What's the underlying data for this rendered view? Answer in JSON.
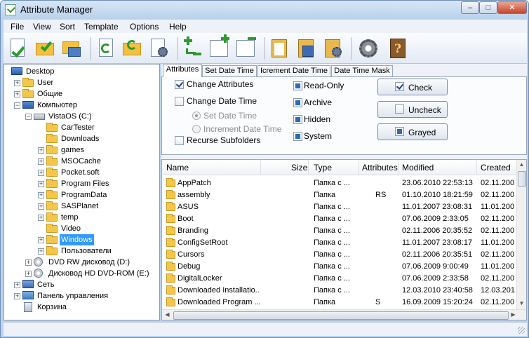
{
  "window": {
    "title": "Attribute Manager",
    "controls": {
      "minimize": "–",
      "maximize": "□",
      "close": "✕"
    }
  },
  "menu": [
    "File",
    "View",
    "Sort",
    "Template",
    "Options",
    "Help"
  ],
  "toolbar": [
    {
      "icon": "document-check-icon"
    },
    {
      "icon": "folder-check-icon"
    },
    {
      "icon": "folder-network-icon"
    },
    {
      "icon": "refresh-doc-icon"
    },
    {
      "icon": "refresh-folder-icon"
    },
    {
      "icon": "doc-settings-icon"
    },
    {
      "icon": "add-remove-icon"
    },
    {
      "icon": "add-to-list-icon"
    },
    {
      "icon": "remove-from-list-icon"
    },
    {
      "icon": "clipboard-icon"
    },
    {
      "icon": "clipboard-save-icon"
    },
    {
      "icon": "clipboard-settings-icon"
    },
    {
      "icon": "settings-gear-icon"
    },
    {
      "icon": "help-book-icon"
    }
  ],
  "tree": [
    {
      "label": "Desktop",
      "depth": 0,
      "icon": "desktop-icon",
      "expander": false
    },
    {
      "label": "User",
      "depth": 1,
      "icon": "user-folder-icon",
      "expander": true
    },
    {
      "label": "Общие",
      "depth": 1,
      "icon": "folder-icon",
      "expander": true
    },
    {
      "label": "Компьютер",
      "depth": 1,
      "icon": "computer-icon",
      "expander": true,
      "open": true
    },
    {
      "label": "VistaOS (C:)",
      "depth": 2,
      "icon": "drive-icon",
      "expander": true,
      "open": true
    },
    {
      "label": "CarTester",
      "depth": 3,
      "icon": "folder-icon",
      "expander": false
    },
    {
      "label": "Downloads",
      "depth": 3,
      "icon": "folder-icon",
      "expander": false
    },
    {
      "label": "games",
      "depth": 3,
      "icon": "folder-icon",
      "expander": true
    },
    {
      "label": "MSOCache",
      "depth": 3,
      "icon": "folder-icon",
      "expander": true
    },
    {
      "label": "Pocket.soft",
      "depth": 3,
      "icon": "folder-icon",
      "expander": true
    },
    {
      "label": "Program Files",
      "depth": 3,
      "icon": "folder-icon",
      "expander": true
    },
    {
      "label": "ProgramData",
      "depth": 3,
      "icon": "folder-icon",
      "expander": true
    },
    {
      "label": "SASPlanet",
      "depth": 3,
      "icon": "folder-icon",
      "expander": true
    },
    {
      "label": "temp",
      "depth": 3,
      "icon": "folder-icon",
      "expander": true
    },
    {
      "label": "Video",
      "depth": 3,
      "icon": "folder-icon",
      "expander": false
    },
    {
      "label": "Windows",
      "depth": 3,
      "icon": "folder-icon",
      "expander": true,
      "selected": true
    },
    {
      "label": "Пользователи",
      "depth": 3,
      "icon": "folder-icon",
      "expander": true
    },
    {
      "label": "DVD RW дисковод (D:)",
      "depth": 2,
      "icon": "dvd-drive-icon",
      "expander": true
    },
    {
      "label": "Дисковод HD DVD-ROM (E:)",
      "depth": 2,
      "icon": "dvd-drive-icon",
      "expander": true
    },
    {
      "label": "Сеть",
      "depth": 1,
      "icon": "network-icon",
      "expander": true
    },
    {
      "label": "Панель управления",
      "depth": 1,
      "icon": "control-panel-icon",
      "expander": true
    },
    {
      "label": "Корзина",
      "depth": 1,
      "icon": "recycle-bin-icon",
      "expander": false
    }
  ],
  "tabs": [
    "Attributes",
    "Set Date Time",
    "Icrement Date Time",
    "Date Time Mask"
  ],
  "options": {
    "change_attributes": "Change Attributes",
    "change_date_time": "Change Date Time",
    "set_date_time": "Set Date Time",
    "increment_date_time": "Increment Date Time",
    "recurse_subfolders": "Recurse Subfolders"
  },
  "attributes": [
    "Read-Only",
    "Archive",
    "Hidden",
    "System"
  ],
  "buttons": {
    "check": "Check",
    "uncheck": "Uncheck",
    "grayed": "Grayed"
  },
  "columns": [
    "Name",
    "Size",
    "Type",
    "Attributes",
    "Modified",
    "Created"
  ],
  "files": [
    {
      "name": "AppPatch",
      "size": "",
      "type": "Папка с ...",
      "attributes": "",
      "modified": "23.06.2010 22:53:13",
      "created": "02.11.200"
    },
    {
      "name": "assembly",
      "size": "",
      "type": "Папка",
      "attributes": "RS",
      "modified": "01.10.2010 18:21:59",
      "created": "02.11.200"
    },
    {
      "name": "ASUS",
      "size": "",
      "type": "Папка с ...",
      "attributes": "",
      "modified": "11.01.2007 23:08:31",
      "created": "11.01.200"
    },
    {
      "name": "Boot",
      "size": "",
      "type": "Папка с ...",
      "attributes": "",
      "modified": "07.06.2009 2:33:05",
      "created": "02.11.200"
    },
    {
      "name": "Branding",
      "size": "",
      "type": "Папка с ...",
      "attributes": "",
      "modified": "02.11.2006 20:35:52",
      "created": "02.11.200"
    },
    {
      "name": "ConfigSetRoot",
      "size": "",
      "type": "Папка с ...",
      "attributes": "",
      "modified": "11.01.2007 23:08:17",
      "created": "11.01.200"
    },
    {
      "name": "Cursors",
      "size": "",
      "type": "Папка с ...",
      "attributes": "",
      "modified": "02.11.2006 20:35:51",
      "created": "02.11.200"
    },
    {
      "name": "Debug",
      "size": "",
      "type": "Папка с ...",
      "attributes": "",
      "modified": "07.06.2009 9:00:49",
      "created": "11.01.200"
    },
    {
      "name": "DigitalLocker",
      "size": "",
      "type": "Папка с ...",
      "attributes": "",
      "modified": "07.06.2009 2:33:58",
      "created": "02.11.200"
    },
    {
      "name": "Downloaded Installatio...",
      "size": "",
      "type": "Папка с ...",
      "attributes": "",
      "modified": "12.03.2010 23:40:58",
      "created": "12.03.201"
    },
    {
      "name": "Downloaded Program ...",
      "size": "",
      "type": "Папка",
      "attributes": "S",
      "modified": "16.09.2009 15:20:24",
      "created": "02.11.200"
    }
  ]
}
